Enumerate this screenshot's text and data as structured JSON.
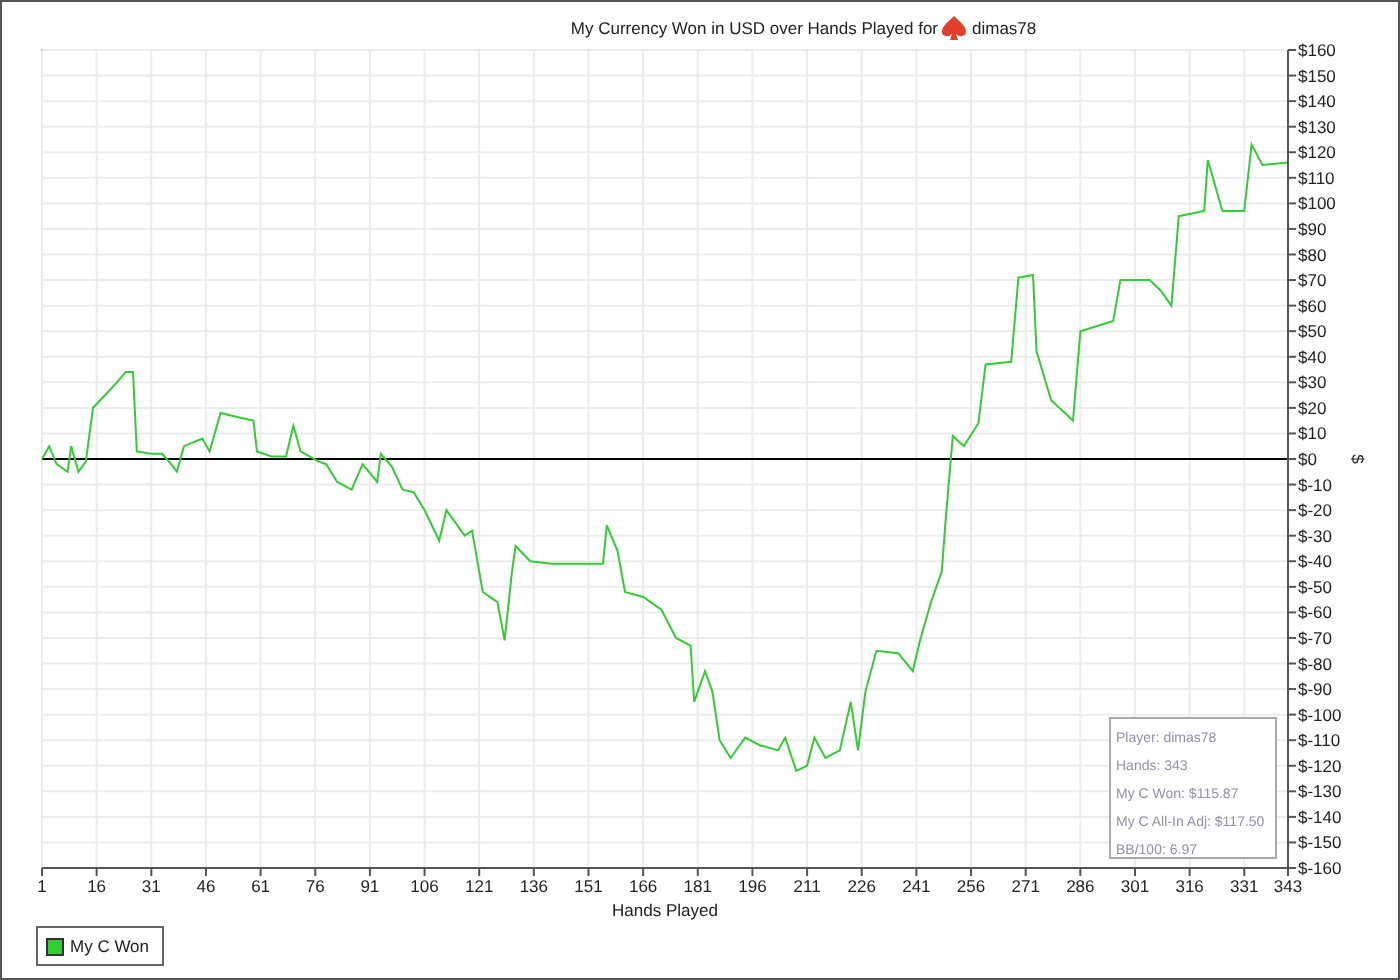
{
  "chart_data": {
    "type": "line",
    "title": "My Currency Won in USD over Hands Played for",
    "xlabel": "Hands Played",
    "ylabel": "$",
    "x": [
      1,
      3,
      5,
      8,
      9,
      11,
      13,
      15,
      17,
      21,
      24,
      26,
      27,
      31,
      34,
      37,
      38,
      40,
      45,
      47,
      50,
      56,
      59,
      60,
      64,
      68,
      70,
      72,
      77,
      79,
      82,
      86,
      89,
      93,
      94,
      97,
      100,
      103,
      106,
      110,
      112,
      115,
      117,
      119,
      122,
      126,
      128,
      130,
      131,
      135,
      141,
      149,
      155,
      156,
      159,
      161,
      166,
      171,
      175,
      179,
      180,
      183,
      185,
      187,
      190,
      194,
      198,
      203,
      205,
      208,
      211,
      213,
      216,
      220,
      223,
      225,
      227,
      230,
      236,
      240,
      242,
      245,
      248,
      249,
      251,
      254,
      258,
      260,
      267,
      269,
      273,
      274,
      278,
      281,
      284,
      286,
      295,
      297,
      305,
      308,
      311,
      313,
      320,
      321,
      325,
      331,
      333,
      336,
      343
    ],
    "series": [
      {
        "name": "My C Won",
        "color": "#33cc33",
        "values": [
          0,
          5,
          -2,
          -5,
          5,
          -5,
          -1,
          20,
          23,
          29,
          34,
          34,
          3,
          2,
          2,
          -3,
          -5,
          5,
          8,
          3,
          18,
          16,
          15,
          3,
          1,
          1,
          13,
          3,
          -1,
          -2,
          -9,
          -12,
          -2,
          -9,
          2,
          -3,
          -12,
          -13,
          -20,
          -32,
          -20,
          -26,
          -30,
          -28,
          -52,
          -56,
          -71,
          -44,
          -34,
          -40,
          -41,
          -41,
          -41,
          -26,
          -36,
          -52,
          -54,
          -59,
          -70,
          -73,
          -95,
          -83,
          -91,
          -110,
          -117,
          -109,
          -112,
          -114,
          -109,
          -122,
          -120,
          -109,
          -117,
          -114,
          -95,
          -114,
          -91,
          -75,
          -76,
          -83,
          -71,
          -56,
          -44,
          -24,
          9,
          5,
          14,
          37,
          38,
          71,
          72,
          42,
          23,
          19,
          15,
          50,
          54,
          70,
          70,
          66,
          60,
          95,
          97,
          117,
          97,
          97,
          123,
          115,
          116
        ]
      }
    ],
    "grid": true,
    "xlim": [
      1,
      343
    ],
    "ylim": [
      -160,
      160
    ],
    "xticks": [
      1,
      16,
      31,
      46,
      61,
      76,
      91,
      106,
      121,
      136,
      151,
      166,
      181,
      196,
      211,
      226,
      241,
      256,
      271,
      286,
      301,
      316,
      331,
      343
    ],
    "yticks": [
      {
        "value": 160,
        "label": "$160"
      },
      {
        "value": 150,
        "label": "$150"
      },
      {
        "value": 140,
        "label": "$140"
      },
      {
        "value": 130,
        "label": "$130"
      },
      {
        "value": 120,
        "label": "$120"
      },
      {
        "value": 110,
        "label": "$110"
      },
      {
        "value": 100,
        "label": "$100"
      },
      {
        "value": 90,
        "label": "$90"
      },
      {
        "value": 80,
        "label": "$80"
      },
      {
        "value": 70,
        "label": "$70"
      },
      {
        "value": 60,
        "label": "$60"
      },
      {
        "value": 50,
        "label": "$50"
      },
      {
        "value": 40,
        "label": "$40"
      },
      {
        "value": 30,
        "label": "$30"
      },
      {
        "value": 20,
        "label": "$20"
      },
      {
        "value": 10,
        "label": "$10"
      },
      {
        "value": 0,
        "label": "$0"
      },
      {
        "value": -10,
        "label": "$-10"
      },
      {
        "value": -20,
        "label": "$-20"
      },
      {
        "value": -30,
        "label": "$-30"
      },
      {
        "value": -40,
        "label": "$-40"
      },
      {
        "value": -50,
        "label": "$-50"
      },
      {
        "value": -60,
        "label": "$-60"
      },
      {
        "value": -70,
        "label": "$-70"
      },
      {
        "value": -80,
        "label": "$-80"
      },
      {
        "value": -90,
        "label": "$-90"
      },
      {
        "value": -100,
        "label": "$-100"
      },
      {
        "value": -110,
        "label": "$-110"
      },
      {
        "value": -120,
        "label": "$-120"
      },
      {
        "value": -130,
        "label": "$-130"
      },
      {
        "value": -140,
        "label": "$-140"
      },
      {
        "value": -150,
        "label": "$-150"
      },
      {
        "value": -160,
        "label": "$-160"
      }
    ]
  },
  "title_player": "dimas78",
  "stats": [
    "Player: dimas78",
    "Hands: 343",
    "My C Won: $115.87",
    "My C All-In Adj: $117.50",
    "BB/100: 6.97"
  ]
}
